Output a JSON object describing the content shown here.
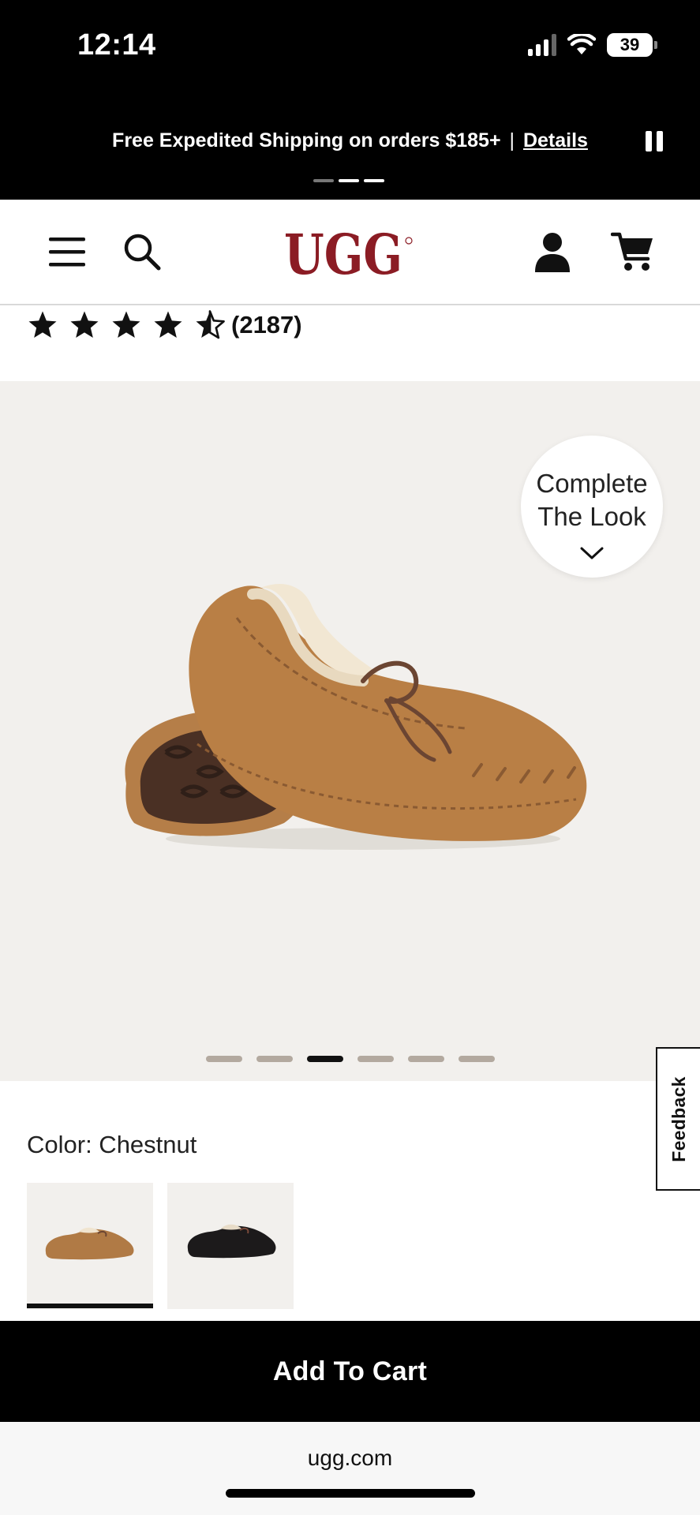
{
  "status_bar": {
    "time": "12:14",
    "battery": "39",
    "signal_bars": 4,
    "signal_bars_filled": 3
  },
  "promo": {
    "text": "Free Expedited Shipping on orders $185+",
    "separator": "|",
    "link": "Details",
    "pause_icon": "pause-icon"
  },
  "header": {
    "menu_icon": "hamburger-menu-icon",
    "search_icon": "search-icon",
    "logo_text": "UGG",
    "account_icon": "account-icon",
    "cart_icon": "cart-icon",
    "brand_color": "#8b1c24"
  },
  "rating": {
    "stars": 4.5,
    "count": "(2187)"
  },
  "gallery": {
    "complete_the_look_line1": "Complete",
    "complete_the_look_line2": "The Look",
    "chevron_icon": "chevron-down-icon",
    "dots_total": 6,
    "active_index": 2
  },
  "feedback": {
    "label": "Feedback"
  },
  "color": {
    "label": "Color: Chestnut",
    "swatches": [
      {
        "name": "chestnut",
        "selected": true,
        "hex": "#b07a45"
      },
      {
        "name": "black",
        "selected": false,
        "hex": "#1c1a1b"
      }
    ]
  },
  "cart": {
    "add_to_cart_label": "Add To Cart"
  },
  "browser": {
    "url": "ugg.com"
  }
}
